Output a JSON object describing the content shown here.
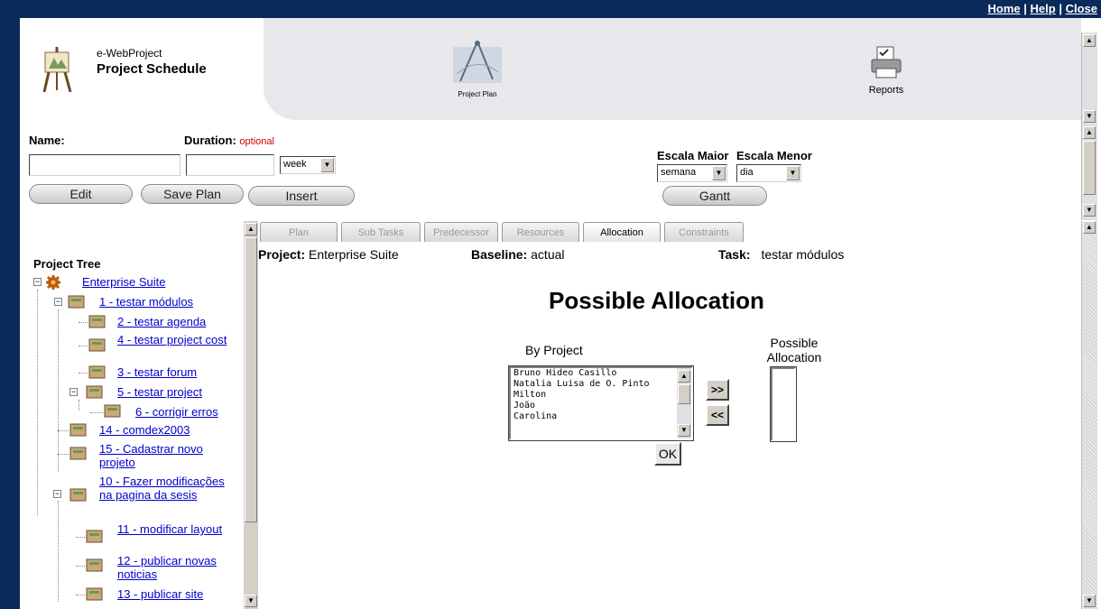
{
  "top_links": [
    "Home",
    "Help",
    "Close"
  ],
  "app": {
    "subtitle": "e-WebProject",
    "title": "Project Schedule"
  },
  "nav": {
    "plan_label": "Project Plan",
    "reports_label": "Reports"
  },
  "form": {
    "name_label": "Name:",
    "duration_label": "Duration:",
    "optional_label": "optional",
    "name_value": "",
    "duration_value": "",
    "unit_value": "week",
    "escala_maior_label": "Escala Maior",
    "escala_menor_label": "Escala Menor",
    "escala_maior_value": "semana",
    "escala_menor_value": "dia",
    "edit_button": "Edit",
    "save_button": "Save Plan",
    "insert_button": "Insert",
    "gantt_button": "Gantt"
  },
  "tree": {
    "title": "Project Tree",
    "items": [
      {
        "label": "Enterprise Suite"
      },
      {
        "label": "1 - testar módulos"
      },
      {
        "label": "2 - testar agenda"
      },
      {
        "label": "4 - testar project cost"
      },
      {
        "label": "3 - testar forum"
      },
      {
        "label": "5 - testar project"
      },
      {
        "label": "6 - corrigir erros"
      },
      {
        "label": "14 - comdex2003"
      },
      {
        "label": "15 - Cadastrar novo projeto"
      },
      {
        "label": "10 - Fazer modificações na pagina da sesis"
      },
      {
        "label": "11 - modificar layout"
      },
      {
        "label": "12 - publicar novas noticias"
      },
      {
        "label": "13 - publicar site"
      }
    ]
  },
  "tabs": [
    "Plan",
    "Sub Tasks",
    "Predecessor",
    "Resources",
    "Allocation",
    "Constraints"
  ],
  "active_tab": "Allocation",
  "info": {
    "project_label": "Project:",
    "project_value": "Enterprise Suite",
    "baseline_label": "Baseline:",
    "baseline_value": "actual",
    "task_label": "Task:",
    "task_value": "testar módulos"
  },
  "allocation": {
    "title": "Possible Allocation",
    "by_project_label": "By Project",
    "possible_label_1": "Possible",
    "possible_label_2": "Allocation",
    "people": [
      "Bruno Hideo Casillo",
      "Natalia Luisa de O. Pinto",
      "Milton",
      "João",
      "Carolina"
    ],
    "add_button": ">>",
    "remove_button": "<<",
    "ok_button": "OK"
  }
}
